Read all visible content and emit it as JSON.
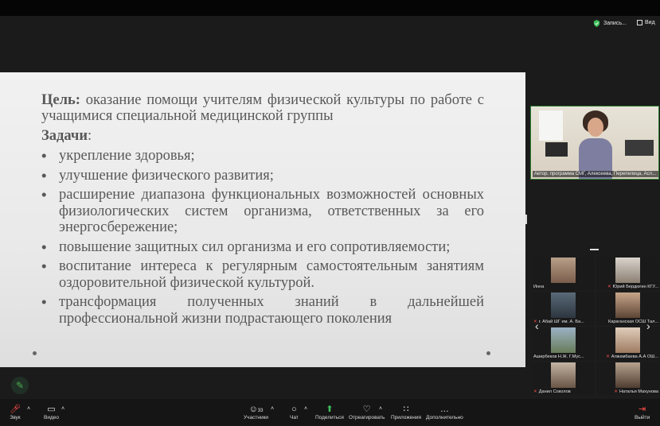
{
  "status": {
    "recording_label": "Запись...",
    "view_label": "Вид"
  },
  "slide": {
    "goal_label": "Цель:",
    "goal_text": " оказание помощи учителям физической культуры по работе с учащимися специальной медицинской группы",
    "tasks_label": "Задачи",
    "tasks_colon": ":",
    "tasks": [
      "укрепление здоровья;",
      "улучшение физического развития;",
      "расширение диапазона функциональных возможностей основных физиологических систем организма, ответственных за его энергосбережение;",
      "повышение защитных сил организма и его сопротивляемости;",
      "воспитание интереса к регулярным самостоятельным занятиям оздоровительной физической культурой.",
      "трансформация полученных знаний в дальнейшей профессиональной жизни подрастающего поколения"
    ]
  },
  "speaker": {
    "name": "Автор. программа СМГ, Алексеева, Перепелица, Асл..."
  },
  "gallery": {
    "participants": [
      {
        "name": "Инна",
        "muted": false
      },
      {
        "name": "Юрий Бердюгин КГУ...",
        "muted": true
      },
      {
        "name": "г. Абай ШГ им. А. Ба...",
        "muted": true
      },
      {
        "name": "Караганская ОСШ Тал...",
        "muted": false
      },
      {
        "name": "Аширбеков Н.Ж. Г.Мус...",
        "muted": false
      },
      {
        "name": "Алжамбаева А.А ОШ...",
        "muted": true
      },
      {
        "name": "Данил Соколов",
        "muted": true
      },
      {
        "name": "Наталья Махунова",
        "muted": true
      }
    ]
  },
  "toolbar": {
    "audio": "Звук",
    "video": "Видео",
    "participants": "Участники",
    "participants_count": "33",
    "chat": "Чат",
    "share": "Поделиться",
    "react": "Отреагировать",
    "apps": "Приложения",
    "more": "Дополнительно",
    "leave": "Выйти"
  },
  "colors": {
    "accent_green": "#4caf50",
    "muted_red": "#ff4d4d"
  }
}
